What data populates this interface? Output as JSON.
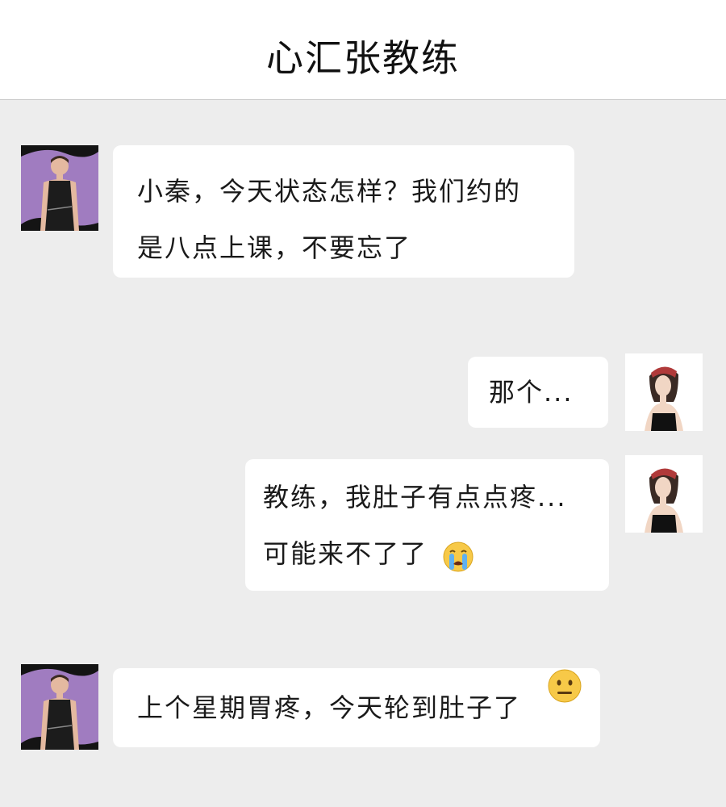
{
  "header": {
    "title": "心汇张教练"
  },
  "messages": [
    {
      "sender": "coach",
      "lines": [
        "小秦，今天状态怎样？我们约的",
        "是八点上课，不要忘了"
      ]
    },
    {
      "sender": "me",
      "lines": [
        "那个..."
      ]
    },
    {
      "sender": "me",
      "lines": [
        "教练，我肚子有点点疼...",
        "可能来不了了"
      ],
      "emoji": "loudly-crying-face-emoji"
    },
    {
      "sender": "coach",
      "lines": [
        "上个星期胃疼，今天轮到肚子了"
      ],
      "emoji": "neutral-face-emoji"
    }
  ],
  "colors": {
    "background": "#ededed",
    "bubble": "#ffffff",
    "header": "#ffffff",
    "coach_avatar_bg": "#a07cc0",
    "emoji_yellow": "#f7c948"
  }
}
